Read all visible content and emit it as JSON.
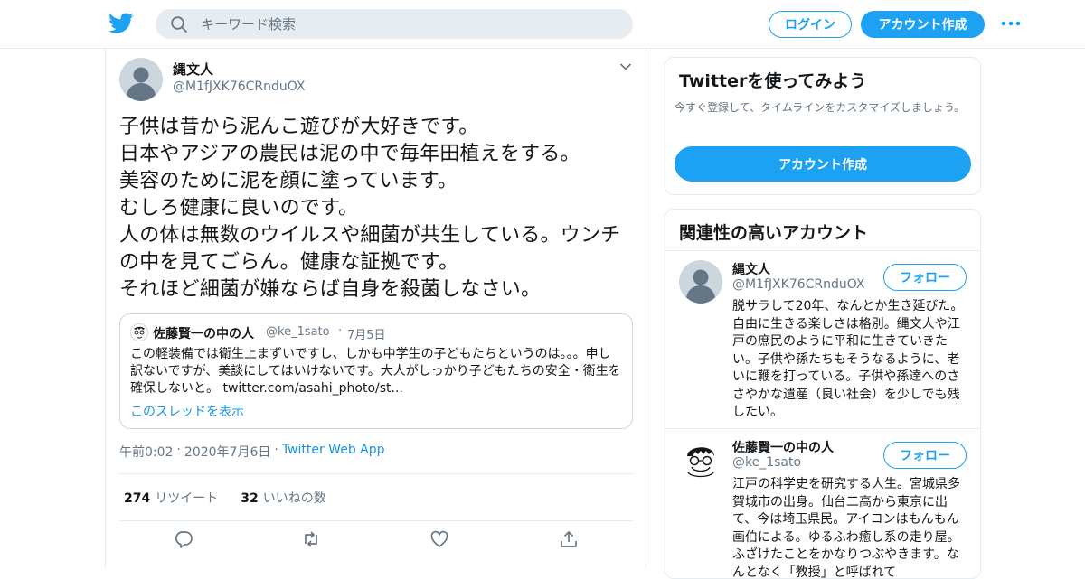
{
  "header": {
    "search_placeholder": "キーワード検索",
    "login_label": "ログイン",
    "signup_label": "アカウント作成",
    "icons": {
      "logo": "twitter-bird-icon",
      "search": "search-icon",
      "more": "more-dots-icon"
    }
  },
  "tweet": {
    "author_name": "縄文人",
    "author_handle": "@M1fJXK76CRnduOX",
    "text": "子供は昔から泥んこ遊びが大好きです。\n日本やアジアの農民は泥の中で毎年田植えをする。\n美容のために泥を顔に塗っています。\nむしろ健康に良いのです。\n人の体は無数のウイルスや細菌が共生している。ウンチの中を見てごらん。健康な証拠です。\nそれほど細菌が嫌ならば自身を殺菌しなさい。",
    "quote": {
      "author_name": "佐藤賢一の中の人",
      "author_handle": "@ke_1sato",
      "separator": "·",
      "date": "7月5日",
      "text": "この軽装備では衛生上まずいですし、しかも中学生の子どもたちというのは。。。申し訳ないですが、美談にしてはいけないです。大人がしっかり子どもたちの安全・衛生を確保しないと。 twitter.com/asahi_photo/st...",
      "thread_link": "このスレッドを表示"
    },
    "time": "午前0:02",
    "date": "2020年7月6日",
    "separator": "·",
    "app": "Twitter Web App",
    "retweets_count": "274",
    "retweets_label": "リツイート",
    "likes_count": "32",
    "likes_label": "いいねの数",
    "actions": [
      "reply-icon",
      "retweet-icon",
      "like-icon",
      "share-icon"
    ]
  },
  "sidebar": {
    "signup_card": {
      "title": "Twitterを使ってみよう",
      "text": "今すぐ登録して、タイムラインをカスタマイズしましょう。",
      "button": "アカウント作成"
    },
    "related": {
      "title": "関連性の高いアカウント",
      "follow_label": "フォロー",
      "accounts": [
        {
          "name": "縄文人",
          "handle": "@M1fJXK76CRnduOX",
          "bio": "脱サラして20年、なんとか生き延びた。自由に生きる楽しさは格別。縄文人や江戸の庶民のように平和に生きていきたい。子供や孫たちもそうなるように、老いに鞭を打っている。子供や孫達へのささやかな遺産（良い社会）を少しでも残したい。"
        },
        {
          "name": "佐藤賢一の中の人",
          "handle": "@ke_1sato",
          "bio": "江戸の科学史を研究する人生。宮城県多賀城市の出身。仙台二高から東京に出て、今は埼玉県民。アイコンはもんもん画伯による。ゆるふわ癒し系の走り屋。ふざけたことをかなりつぶやきます。なんとなく「教授」と呼ばれて"
        }
      ]
    }
  },
  "colors": {
    "accent": "#1da1f2",
    "link": "#1b95e0",
    "muted": "#657786",
    "border": "#e6ecf0"
  }
}
